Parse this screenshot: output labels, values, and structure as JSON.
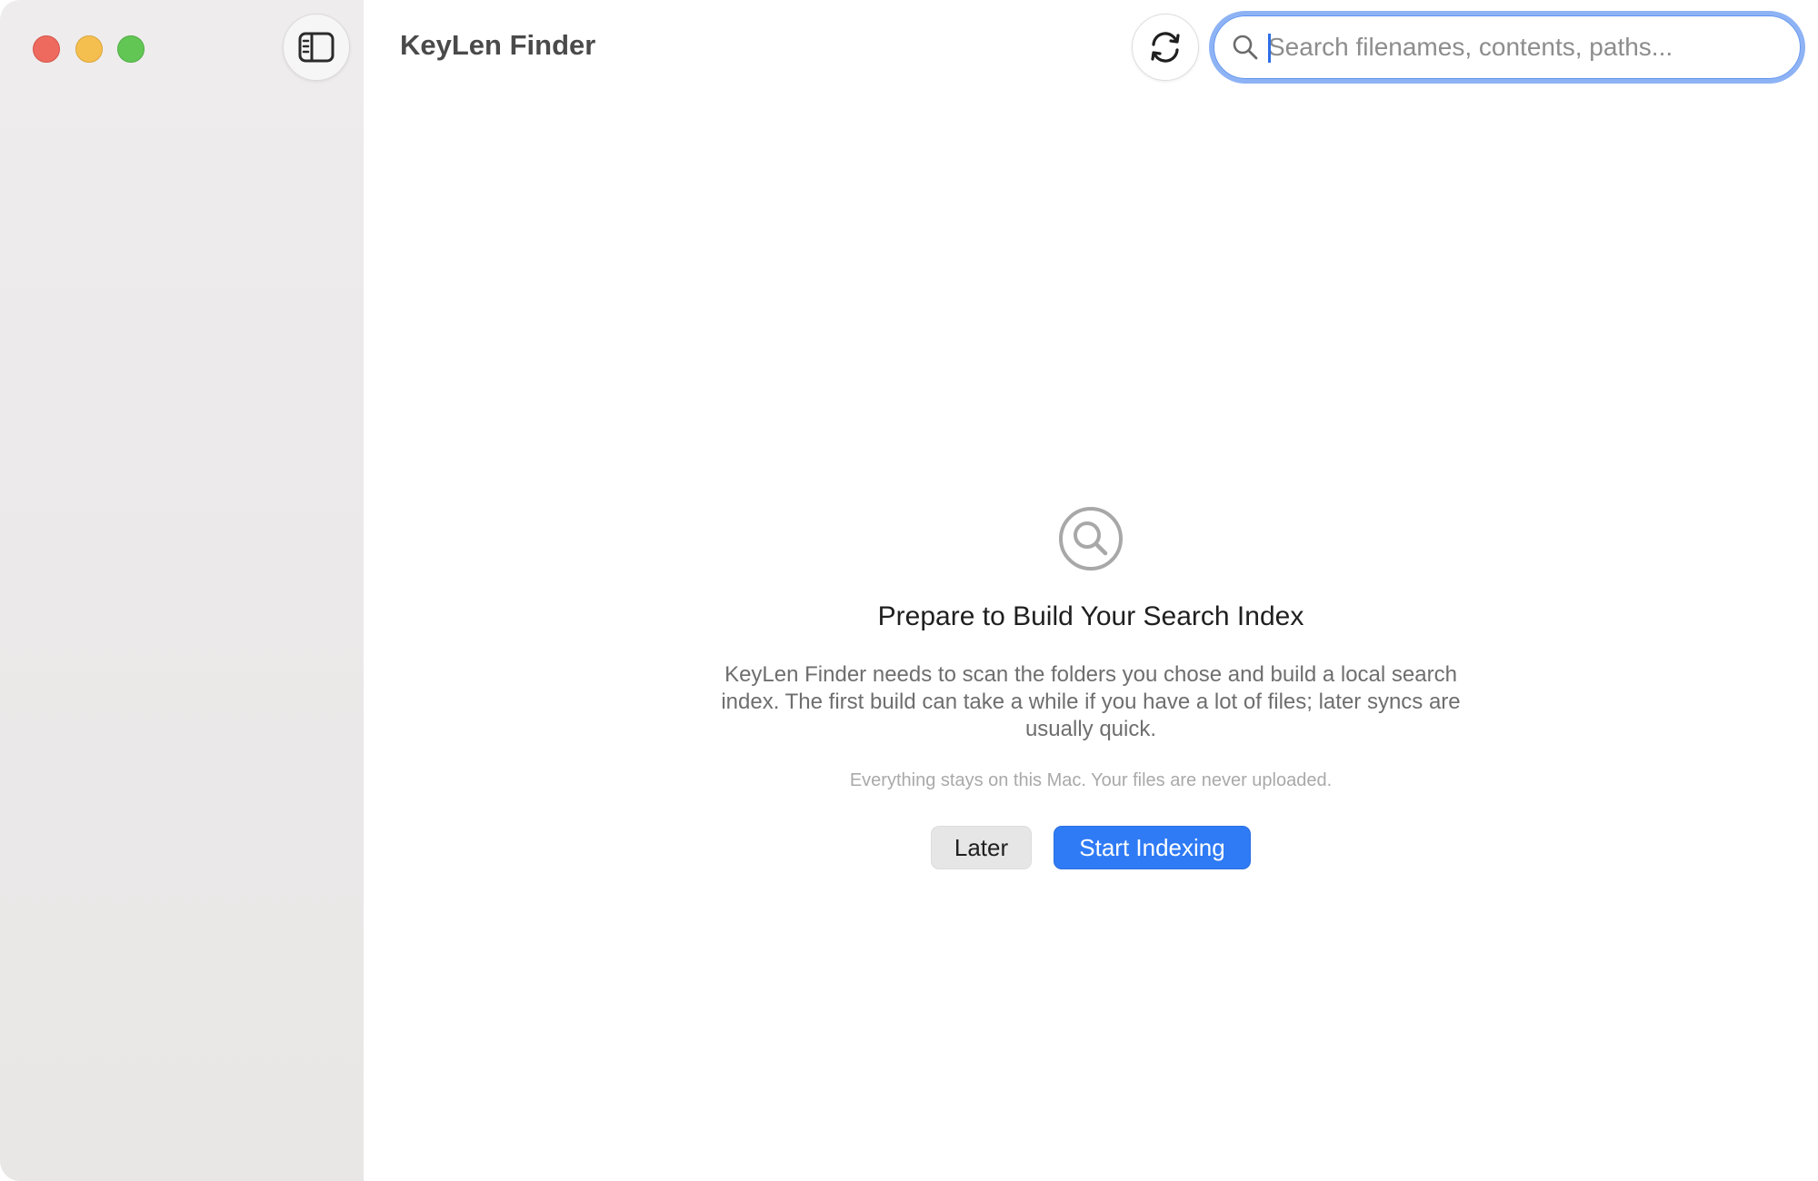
{
  "window": {
    "title": "KeyLen Finder"
  },
  "toolbar": {
    "sidebar_toggle_icon": "sidebar-icon",
    "refresh_icon": "refresh-icon",
    "search": {
      "placeholder": "Search filenames, contents, paths...",
      "value": "",
      "icon": "magnifier-icon"
    }
  },
  "empty_state": {
    "icon": "magnifier-circle-icon",
    "title": "Prepare to Build Your Search Index",
    "description": "KeyLen Finder needs to scan the folders you chose and build a local search index. The first build can take a while if you have a lot of files; later syncs are usually quick.",
    "note": "Everything stays on this Mac. Your files are never uploaded.",
    "secondary_button": "Later",
    "primary_button": "Start Indexing"
  },
  "colors": {
    "accent": "#2f7bf5",
    "focus_ring": "#8eb3f5",
    "close": "#ee6a5f",
    "minimize": "#f5bf4f",
    "zoom": "#62c655"
  }
}
